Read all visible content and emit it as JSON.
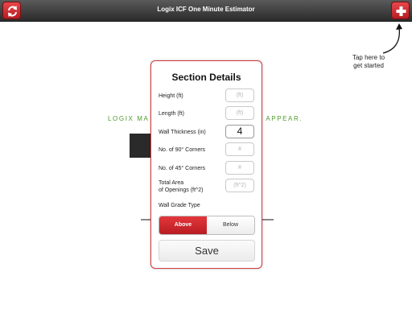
{
  "header": {
    "title": "Logix ICF One Minute Estimator",
    "refresh_icon": "refresh-icon",
    "add_icon": "plus-icon"
  },
  "hint": {
    "line1": "Tap here to",
    "line2": "get started"
  },
  "background": {
    "text_left": "LOGIX MA",
    "text_right": "S APPEAR."
  },
  "modal": {
    "title": "Section Details",
    "fields": [
      {
        "label": "Height (ft)",
        "value": "",
        "placeholder": "(ft)"
      },
      {
        "label": "Length (ft)",
        "value": "",
        "placeholder": "(ft)"
      },
      {
        "label": "Wall Thickness (in)",
        "value": "4",
        "placeholder": ""
      },
      {
        "label": "No. of 90° Corners",
        "value": "",
        "placeholder": "#"
      },
      {
        "label": "No. of 45° Corners",
        "value": "",
        "placeholder": "#"
      },
      {
        "label_line1": "Total Area",
        "label_line2": "of Openings (ft^2)",
        "value": "",
        "placeholder": "(ft^2)"
      }
    ],
    "grade_label": "Wall Grade Type",
    "grade_options": [
      "Above",
      "Below"
    ],
    "grade_selected": "Above",
    "save_label": "Save"
  },
  "colors": {
    "accent_red": "#c8262b",
    "top_bar": "#3a3a3a",
    "background_text_green": "#4f9a2e"
  }
}
